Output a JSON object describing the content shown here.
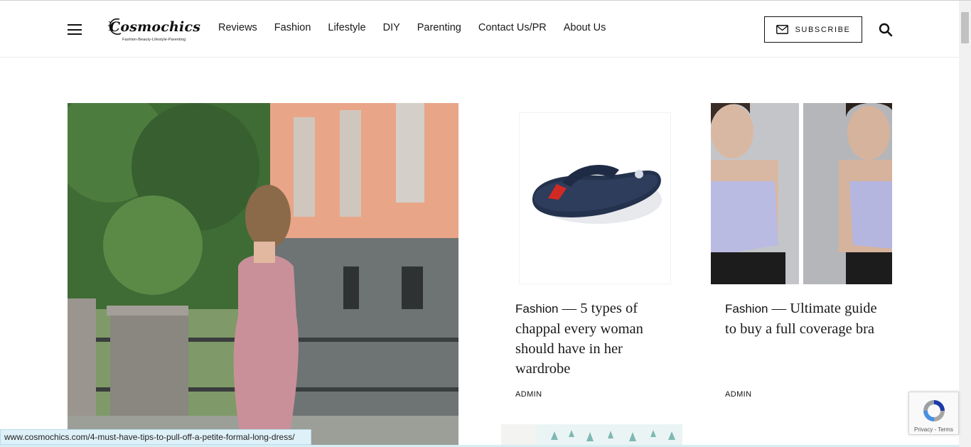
{
  "header": {
    "logo_text": "Cosmochics",
    "logo_tagline": "Fashion-Beauty-Lifestyle-Parenting",
    "nav": [
      "Reviews",
      "Fashion",
      "Lifestyle",
      "DIY",
      "Parenting",
      "Contact Us/PR",
      "About Us"
    ],
    "subscribe_label": "SUBSCRIBE"
  },
  "posts": [
    {
      "category": "Fashion",
      "title": "— 5 types of chappal every woman should have in her wardrobe",
      "author": "ADMIN"
    },
    {
      "category": "Fashion",
      "title": "— Ultimate guide to buy a full coverage bra",
      "author": "ADMIN"
    }
  ],
  "status_bar": {
    "url": "www.cosmochics.com/4-must-have-tips-to-pull-off-a-petite-formal-long-dress/"
  },
  "recaptcha": {
    "text": "Privacy - Terms"
  },
  "icons": [
    "hamburger-menu-icon",
    "mail-icon",
    "search-icon",
    "recaptcha-icon"
  ],
  "colors": {
    "text": "#111111",
    "status_bar_bg": "#dff1f8",
    "header_border": "#ececec"
  }
}
